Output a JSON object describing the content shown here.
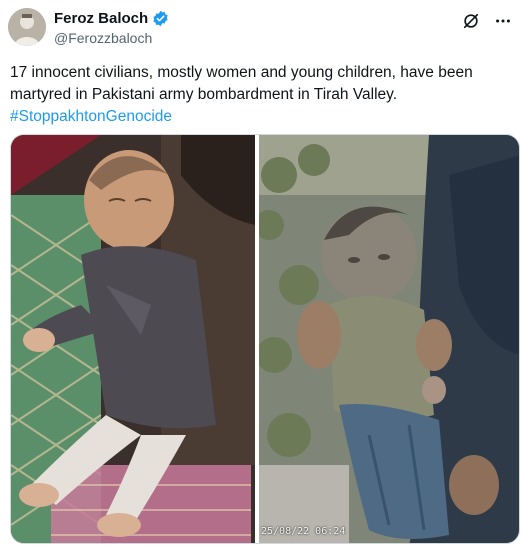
{
  "author": {
    "display_name": "Feroz Baloch",
    "handle": "@Ferozzbaloch",
    "verified_icon": "verified-badge-icon"
  },
  "actions": {
    "grok_icon": "grok-icon",
    "more_icon": "more-dots-icon"
  },
  "tweet": {
    "text": "17 innocent civilians, mostly women and young children, have been martyred in Pakistani army bombardment in Tirah Valley.",
    "hashtag": "#StoppakhtonGenocide"
  },
  "media": {
    "photo_right_timestamp": "25/08/22 06:24"
  },
  "colors": {
    "accent": "#1d9bf0",
    "text": "#0f1419",
    "secondary": "#536471",
    "border": "#cfd9de"
  }
}
